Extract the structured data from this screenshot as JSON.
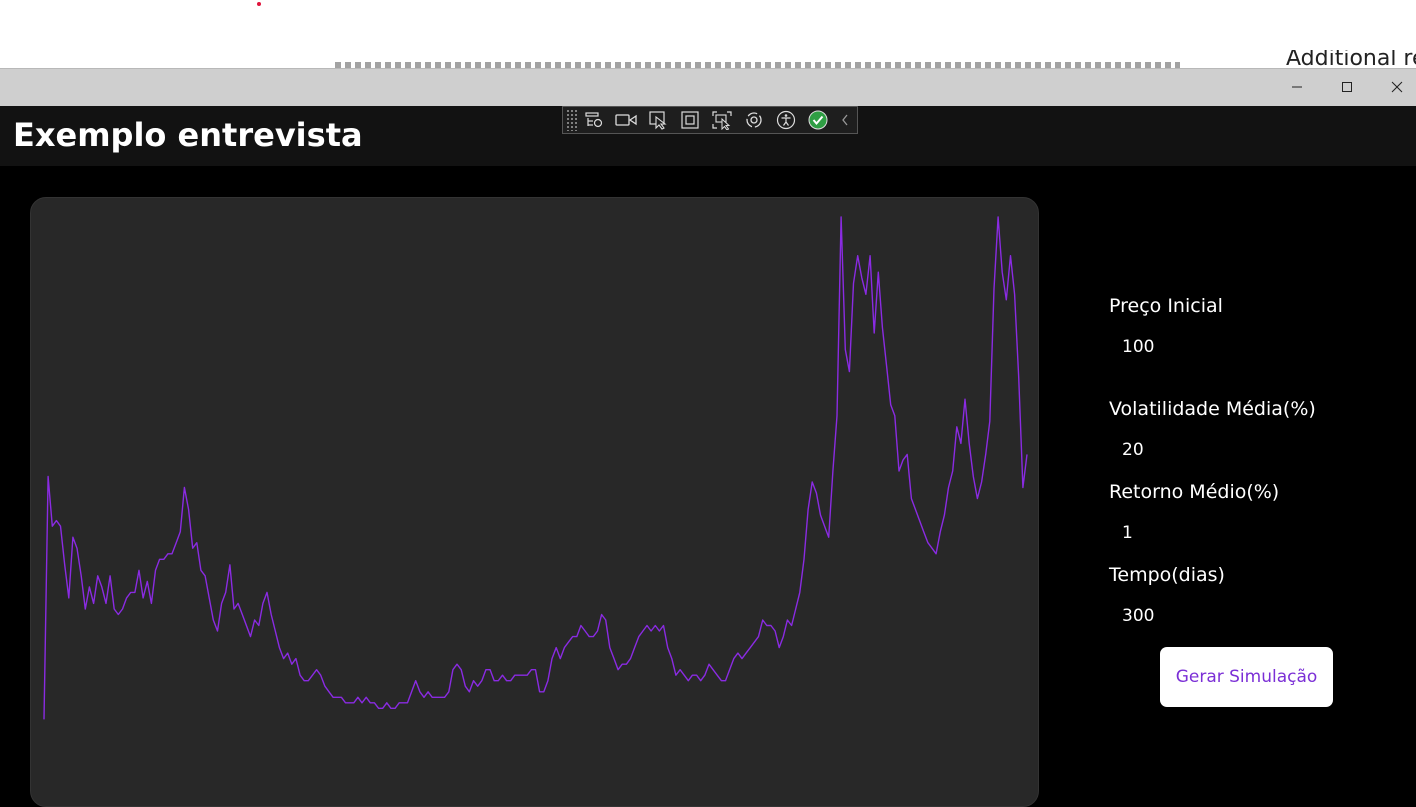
{
  "background": {
    "partial_text": "Additional re",
    "dot_color": "#e0143c"
  },
  "window": {
    "controls": {
      "minimize": "minimize-icon",
      "maximize": "maximize-icon",
      "close": "close-icon"
    }
  },
  "app": {
    "title": "Exemplo entrevista"
  },
  "debug_toolbar": {
    "icons": [
      "live-visual-tree-icon",
      "video-icon",
      "select-element-icon",
      "display-layout-adorners-icon",
      "track-focus-icon",
      "hot-reload-icon",
      "accessibility-icon",
      "checkmark-icon",
      "collapse-chevron-icon"
    ]
  },
  "form": {
    "initial_price": {
      "label": "Preço Inicial",
      "value": "100"
    },
    "volatility": {
      "label": "Volatilidade Média(%)",
      "value": "20"
    },
    "mean_return": {
      "label": "Retorno Médio(%)",
      "value": "1"
    },
    "time_days": {
      "label": "Tempo(dias)",
      "value": "300"
    },
    "generate_button": "Gerar Simulação"
  },
  "colors": {
    "line": "#8a2be2",
    "button_text": "#7b2fd6",
    "panel": "#282828"
  },
  "chart_data": {
    "type": "line",
    "title": "",
    "xlabel": "",
    "ylabel": "",
    "grid": false,
    "x_range": [
      0,
      300
    ],
    "y_range": [
      0,
      100
    ],
    "series": [
      {
        "values": [
          7,
          51,
          42,
          43,
          42,
          35,
          29,
          40,
          38,
          33,
          27,
          31,
          28,
          33,
          31,
          28,
          33,
          27,
          26,
          27,
          29,
          30,
          30,
          34,
          29,
          32,
          28,
          34,
          36,
          36,
          37,
          37,
          39,
          41,
          49,
          45,
          38,
          39,
          34,
          33,
          29,
          25,
          23,
          28,
          30,
          35,
          27,
          28,
          26,
          24,
          22,
          25,
          24,
          28,
          30,
          26,
          23,
          20,
          18,
          19,
          17,
          18,
          15,
          14,
          14,
          15,
          16,
          15,
          13,
          12,
          11,
          11,
          11,
          10,
          10,
          10,
          11,
          10,
          11,
          10,
          10,
          9,
          9,
          10,
          9,
          9,
          10,
          10,
          10,
          12,
          14,
          12,
          11,
          12,
          11,
          11,
          11,
          11,
          12,
          16,
          17,
          16,
          13,
          12,
          14,
          13,
          14,
          16,
          16,
          14,
          14,
          15,
          14,
          14,
          15,
          15,
          15,
          15,
          16,
          16,
          12,
          12,
          14,
          18,
          20,
          18,
          20,
          21,
          22,
          22,
          24,
          23,
          22,
          22,
          23,
          26,
          25,
          20,
          18,
          16,
          17,
          17,
          18,
          20,
          22,
          23,
          24,
          23,
          24,
          23,
          24,
          20,
          18,
          15,
          16,
          15,
          14,
          15,
          15,
          14,
          15,
          17,
          16,
          15,
          14,
          14,
          16,
          18,
          19,
          18,
          19,
          20,
          21,
          22,
          25,
          24,
          24,
          23,
          20,
          22,
          25,
          24,
          27,
          30,
          36,
          45,
          50,
          48,
          44,
          42,
          40,
          52,
          62,
          98,
          74,
          70,
          86,
          91,
          87,
          84,
          91,
          77,
          88,
          78,
          71,
          64,
          62,
          52,
          54,
          55,
          47,
          45,
          43,
          41,
          39,
          38,
          37,
          41,
          44,
          49,
          52,
          60,
          57,
          65,
          57,
          51,
          47,
          50,
          55,
          61,
          85,
          98,
          88,
          83,
          91,
          84,
          69,
          49,
          55
        ]
      }
    ]
  }
}
